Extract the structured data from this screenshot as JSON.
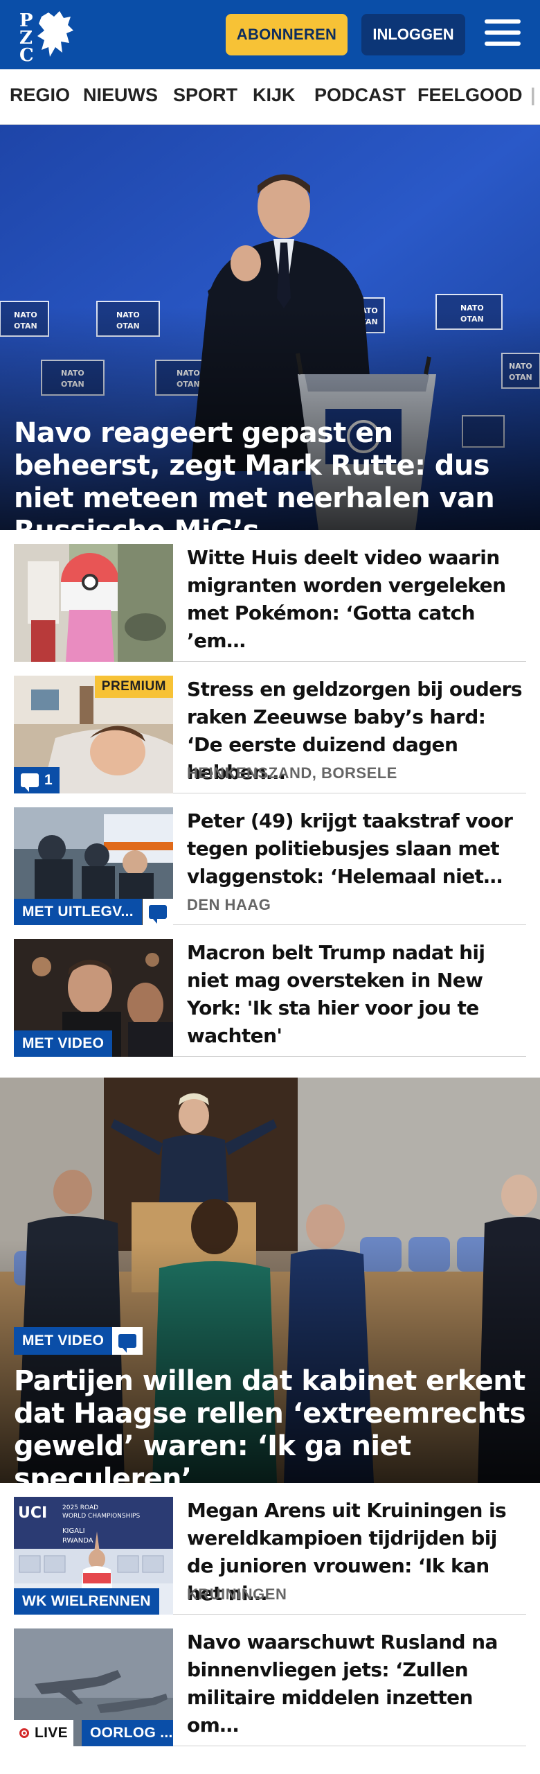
{
  "header": {
    "logo_alt": "PZC",
    "subscribe_label": "ABONNEREN",
    "login_label": "INLOGGEN"
  },
  "nav": {
    "items": [
      "REGIO",
      "NIEUWS",
      "SPORT",
      "KIJK",
      "PODCAST",
      "FEELGOOD"
    ]
  },
  "lead1": {
    "headline": "Navo reageert gepast en beheerst, zegt Mark Rutte: dus niet meteen met neerhalen van Russische MiG’s",
    "backdrop_signs": "NATO OTAN"
  },
  "list1": [
    {
      "title": "Witte Huis deelt video waarin migranten worden vergeleken met Pokémon: ‘Gotta catch ’em…",
      "location": ""
    },
    {
      "title": "Stress en geldzorgen bij ouders raken Zeeuwse baby’s hard: ‘De eerste duizend dagen hebben…",
      "location": "HEINKENSZAND, BORSELE",
      "badge": "PREMIUM",
      "comments": "1"
    },
    {
      "title": "Peter (49) krijgt taakstraf voor tegen politiebusjes slaan met vlaggenstok: ‘Helemaal niet…",
      "location": "DEN HAAG",
      "tag": "MET UITLEGV..."
    },
    {
      "title": "Macron belt Trump nadat hij niet mag oversteken in New York: 'Ik sta hier voor jou te wachten'",
      "location": "",
      "tag": "MET VIDEO"
    }
  ],
  "lead2": {
    "tag": "MET VIDEO",
    "headline": "Partijen willen dat kabinet erkent dat Haagse rellen ‘extreemrechts geweld’ waren: ‘Ik ga niet speculeren’"
  },
  "list2": [
    {
      "title": "Megan Arens uit Kruiningen is wereldkampioen tijdrijden bij de junioren vrouwen: ‘Ik kan het ni…",
      "location": "KRUININGEN",
      "tag": "WK WIELRENNEN",
      "banner_text": "UCI 2025 ROAD WORLD CHAMPIONSHIPS KIGALI RWANDA"
    },
    {
      "title": "Navo waarschuwt Rusland na binnenvliegen jets: ‘Zullen militaire middelen inzetten om…",
      "location": "",
      "live": "LIVE",
      "tag": "OORLOG ..."
    }
  ],
  "colors": {
    "brand_blue": "#0a4ea8",
    "accent_yellow": "#f7c236"
  }
}
